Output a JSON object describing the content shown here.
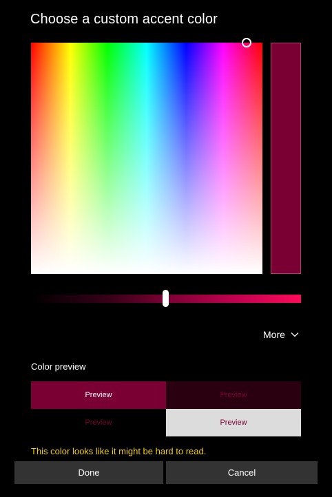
{
  "dialog": {
    "title": "Choose a custom accent color"
  },
  "picker": {
    "selected_color": "#7a0033"
  },
  "more": {
    "label": "More"
  },
  "preview": {
    "label": "Color preview",
    "cells": [
      "Preview",
      "Preview",
      "Preview",
      "Preview"
    ]
  },
  "warning": {
    "text": "This color looks like it might be hard to read."
  },
  "buttons": {
    "done": "Done",
    "cancel": "Cancel"
  },
  "colors": {
    "background": "#000000",
    "accent": "#7a0033",
    "warning": "#f0d000",
    "button": "#333333"
  }
}
